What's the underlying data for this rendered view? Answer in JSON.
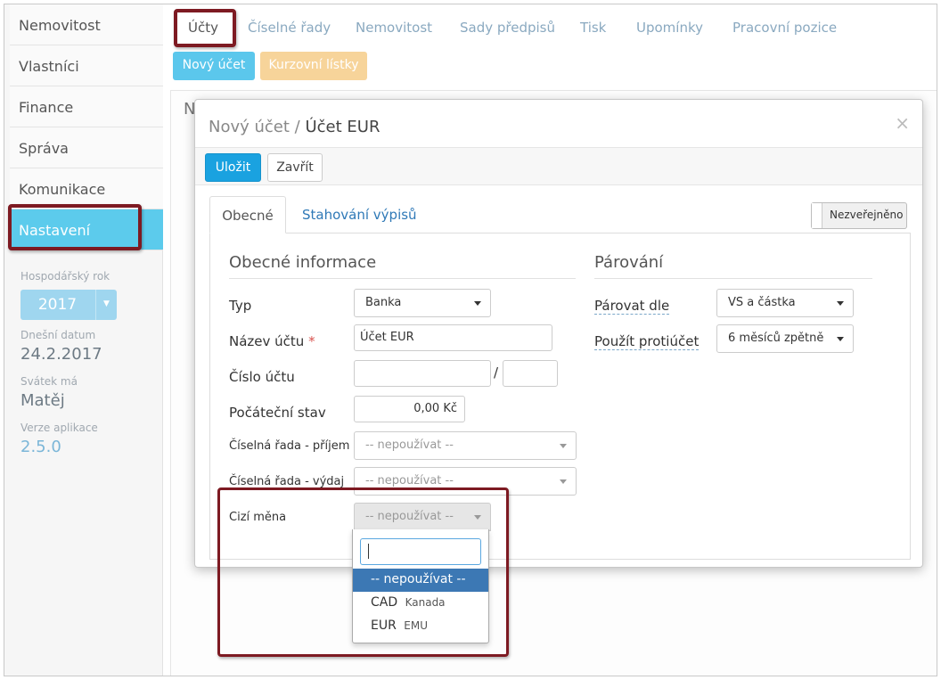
{
  "sidebar": {
    "items": [
      {
        "label": "Nemovitost"
      },
      {
        "label": "Vlastníci"
      },
      {
        "label": "Finance"
      },
      {
        "label": "Správa"
      },
      {
        "label": "Komunikace"
      },
      {
        "label": "Nastavení",
        "active": true
      }
    ],
    "fiscal_year_label": "Hospodářský rok",
    "fiscal_year_value": "2017",
    "today_label": "Dnešní datum",
    "today_value": "24.2.2017",
    "nameday_label": "Svátek má",
    "nameday_value": "Matěj",
    "version_label": "Verze aplikace",
    "version_value": "2.5.0"
  },
  "top_tabs": [
    {
      "label": "Účty",
      "active": true
    },
    {
      "label": "Číselné řady"
    },
    {
      "label": "Nemovitost"
    },
    {
      "label": "Sady předpisů"
    },
    {
      "label": "Tisk"
    },
    {
      "label": "Upomínky"
    },
    {
      "label": "Pracovní pozice"
    }
  ],
  "actions": {
    "new_account": "Nový účet",
    "exchange_rates": "Kurzovní lístky"
  },
  "background_panel": {
    "title_fragment": "N"
  },
  "modal": {
    "title_prefix": "Nový účet /",
    "title_name": "Účet EUR",
    "close_glyph": "×",
    "toolbar": {
      "save": "Uložit",
      "close": "Zavřít"
    },
    "tabs": [
      {
        "label": "Obecné",
        "active": true
      },
      {
        "label": "Stahování výpisů"
      }
    ],
    "publish_toggle": "Nezveřejněno",
    "general": {
      "section_title": "Obecné informace",
      "type_label": "Typ",
      "type_value": "Banka",
      "account_name_label": "Název účtu",
      "required_mark": "*",
      "account_name_value": "Účet EUR",
      "account_number_label": "Číslo účtu",
      "account_number_value": "",
      "bank_code_value": "",
      "slash": "/",
      "initial_balance_label": "Počáteční stav",
      "initial_balance_value": "0,00 Kč",
      "series_income_label": "Číselná řada - příjem",
      "series_income_value": "-- nepoužívat --",
      "series_expense_label": "Číselná řada - výdaj",
      "series_expense_value": "-- nepoužívat --",
      "foreign_currency_label": "Cizí měna",
      "foreign_currency_value": "-- nepoužívat --"
    },
    "pairing": {
      "section_title": "Párování",
      "pair_by_label": "Párovat dle",
      "pair_by_value": "VS a částka",
      "counter_account_label": "Použít protiúčet",
      "counter_account_value": "6 měsíců zpětně"
    }
  },
  "currency_dropdown": {
    "search_value": "",
    "options": [
      {
        "code": "-- nepoužívat --",
        "name": "",
        "selected": true
      },
      {
        "code": "CAD",
        "name": "Kanada"
      },
      {
        "code": "EUR",
        "name": "EMU"
      }
    ]
  },
  "colors": {
    "accent": "#5ccbec",
    "primary_button": "#1aa2e0",
    "secondary_button": "#f7d49a",
    "highlight": "#7d1a22",
    "selected_option": "#3c78b4"
  }
}
